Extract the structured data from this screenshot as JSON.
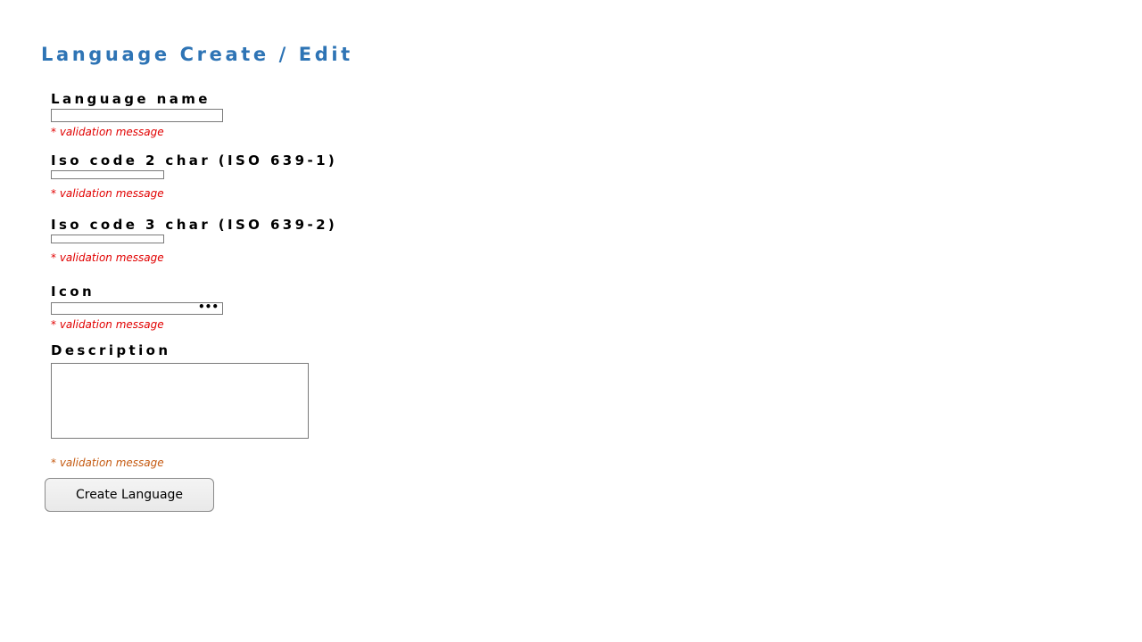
{
  "page": {
    "title": "Language Create / Edit"
  },
  "form": {
    "language_name": {
      "label": "Language name",
      "value": "",
      "validation": "* validation  message"
    },
    "iso2": {
      "label": "Iso code 2 char (ISO 639-1)",
      "value": "",
      "validation": "* validation  message"
    },
    "iso3": {
      "label": "Iso code 3 char (ISO 639-2)",
      "value": "",
      "validation": "* validation  message"
    },
    "icon": {
      "label": "Icon",
      "value": "",
      "browse_glyph": "•••",
      "validation": "* validation  message"
    },
    "description": {
      "label": "Description",
      "value": "",
      "validation": "* validation  message"
    },
    "submit_label": "Create Language"
  },
  "colors": {
    "title": "#2e74b5",
    "validation_error": "#e10000",
    "validation_warning": "#c55a11"
  }
}
